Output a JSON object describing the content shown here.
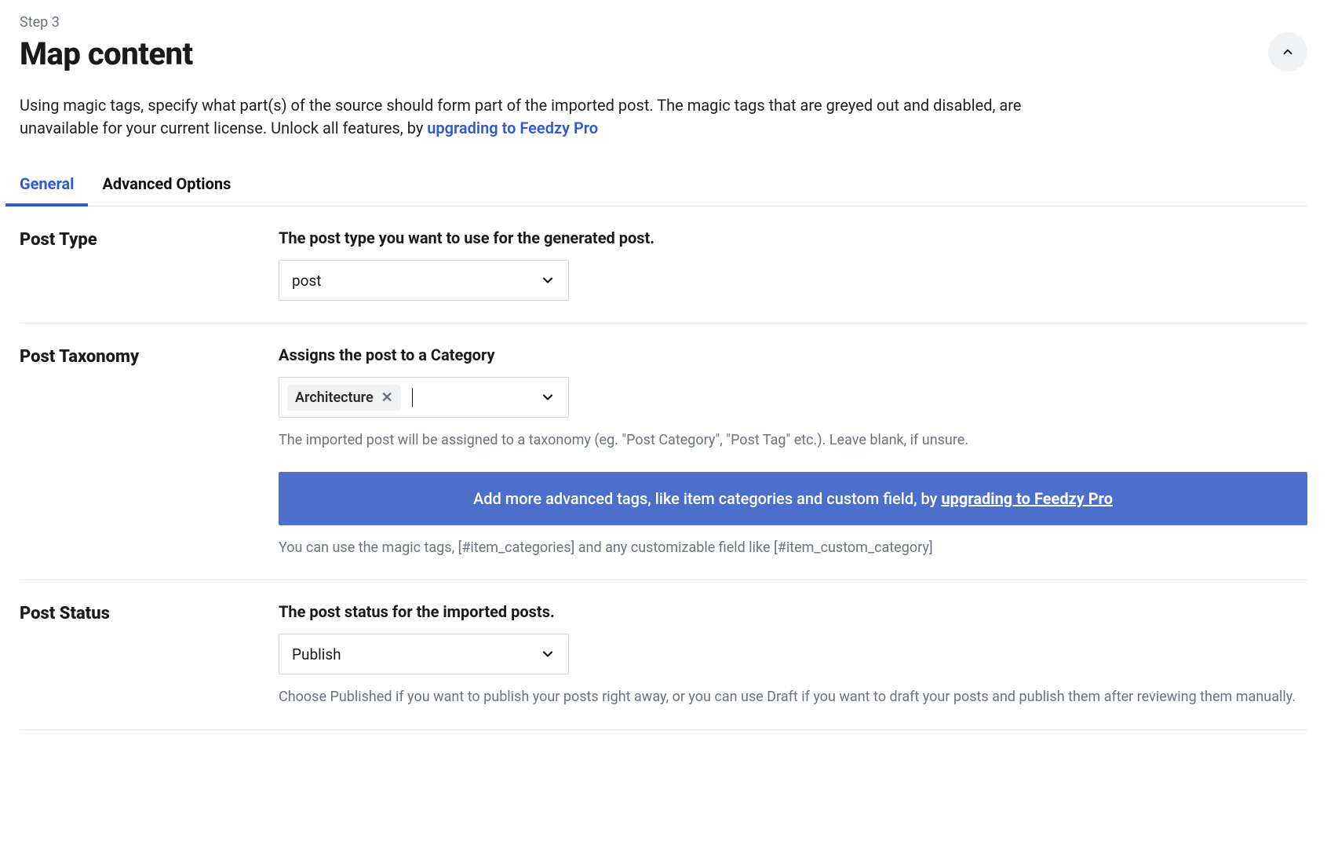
{
  "step_label": "Step 3",
  "title": "Map content",
  "intro_before": "Using magic tags, specify what part(s) of the source should form part of the imported post. The magic tags that are greyed out and disabled, are unavailable for your current license. Unlock all features, by ",
  "intro_link": "upgrading to Feedzy Pro",
  "tabs": {
    "general": "General",
    "advanced": "Advanced Options"
  },
  "post_type": {
    "label": "Post Type",
    "field_title": "The post type you want to use for the generated post.",
    "value": "post"
  },
  "post_taxonomy": {
    "label": "Post Taxonomy",
    "field_title": "Assigns the post to a Category",
    "selected_tag": "Architecture",
    "helper": "The imported post will be assigned to a taxonomy (eg. \"Post Category\", \"Post Tag\" etc.). Leave blank, if unsure.",
    "banner_before": "Add more advanced tags, like item categories and custom field, by ",
    "banner_link": "upgrading to Feedzy Pro",
    "helper2": "You can use the magic tags, [#item_categories] and any customizable field like [#item_custom_category]"
  },
  "post_status": {
    "label": "Post Status",
    "field_title": "The post status for the imported posts.",
    "value": "Publish",
    "helper": "Choose Published if you want to publish your posts right away, or you can use Draft if you want to draft your posts and publish them after reviewing them manually."
  }
}
